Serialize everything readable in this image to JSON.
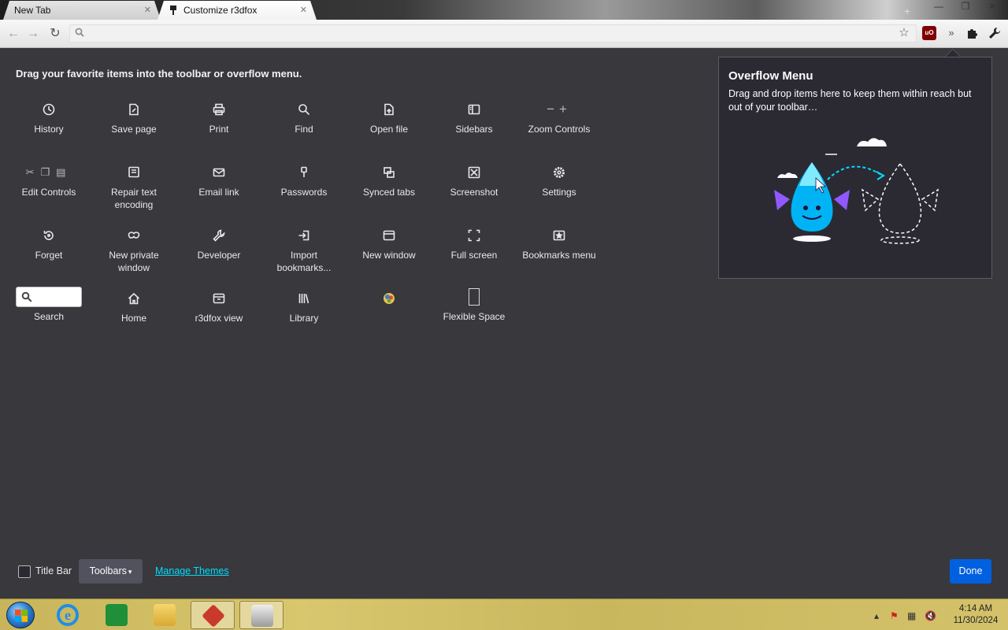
{
  "tabs": [
    {
      "label": "New Tab",
      "active": false
    },
    {
      "label": "Customize r3dfox",
      "active": true
    }
  ],
  "palette": {
    "title": "Drag your favorite items into the toolbar or overflow menu.",
    "items": [
      {
        "label": "History",
        "icon": "history-icon"
      },
      {
        "label": "Save page",
        "icon": "save-page-icon"
      },
      {
        "label": "Print",
        "icon": "print-icon"
      },
      {
        "label": "Find",
        "icon": "find-icon"
      },
      {
        "label": "Open file",
        "icon": "open-file-icon"
      },
      {
        "label": "Sidebars",
        "icon": "sidebars-icon"
      },
      {
        "label": "Zoom Controls",
        "icon": "zoom-icon"
      },
      {
        "label": "Edit Controls",
        "icon": "edit-controls-icon"
      },
      {
        "label": "Repair text encoding",
        "icon": "text-encoding-icon"
      },
      {
        "label": "Email link",
        "icon": "email-icon"
      },
      {
        "label": "Passwords",
        "icon": "key-icon"
      },
      {
        "label": "Synced tabs",
        "icon": "synced-tabs-icon"
      },
      {
        "label": "Screenshot",
        "icon": "screenshot-icon"
      },
      {
        "label": "Settings",
        "icon": "gear-icon"
      },
      {
        "label": "Forget",
        "icon": "forget-icon"
      },
      {
        "label": "New private window",
        "icon": "private-mask-icon"
      },
      {
        "label": "Developer",
        "icon": "wrench-icon"
      },
      {
        "label": "Import bookmarks...",
        "icon": "import-icon"
      },
      {
        "label": "New window",
        "icon": "new-window-icon"
      },
      {
        "label": "Full screen",
        "icon": "fullscreen-icon"
      },
      {
        "label": "Bookmarks menu",
        "icon": "bookmarks-menu-icon"
      },
      {
        "label": "Search",
        "icon": "search-icon"
      },
      {
        "label": "Home",
        "icon": "home-icon"
      },
      {
        "label": "r3dfox view",
        "icon": "firefox-view-icon"
      },
      {
        "label": "Library",
        "icon": "library-icon"
      },
      {
        "label": "",
        "icon": "extension-icon"
      },
      {
        "label": "Flexible Space",
        "icon": "flexible-space-icon"
      }
    ]
  },
  "overflow": {
    "title": "Overflow Menu",
    "description": "Drag and drop items here to keep them within reach but out of your toolbar…"
  },
  "bottom": {
    "title_bar_label": "Title Bar",
    "title_bar_checked": false,
    "toolbars_label": "Toolbars",
    "manage_themes_label": "Manage Themes",
    "done_label": "Done"
  },
  "taskbar": {
    "time": "4:14 AM",
    "date": "11/30/2024"
  },
  "colors": {
    "background": "#38383d",
    "panel": "#2b2a33",
    "done_button": "#0060df",
    "link": "#00ddff"
  }
}
